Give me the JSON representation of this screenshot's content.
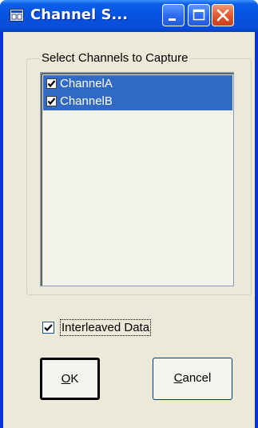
{
  "window": {
    "title": "Channel S...",
    "title_color": "#ffffff",
    "titlebar_color": "#0553e1"
  },
  "titlebar_buttons": {
    "minimize_icon": "minimize-icon",
    "maximize_icon": "maximize-icon",
    "close_icon": "close-icon"
  },
  "group": {
    "legend": "Select Channels to Capture"
  },
  "channels": [
    {
      "label": "ChannelA",
      "checked": true,
      "selected": true
    },
    {
      "label": "ChannelB",
      "checked": true,
      "selected": true
    }
  ],
  "selection_color": "#316ac5",
  "interleaved": {
    "label": "Interleaved Data",
    "checked": true
  },
  "buttons": {
    "ok": {
      "mnemonic": "O",
      "rest": "K"
    },
    "cancel": {
      "mnemonic": "C",
      "rest": "ancel"
    }
  }
}
